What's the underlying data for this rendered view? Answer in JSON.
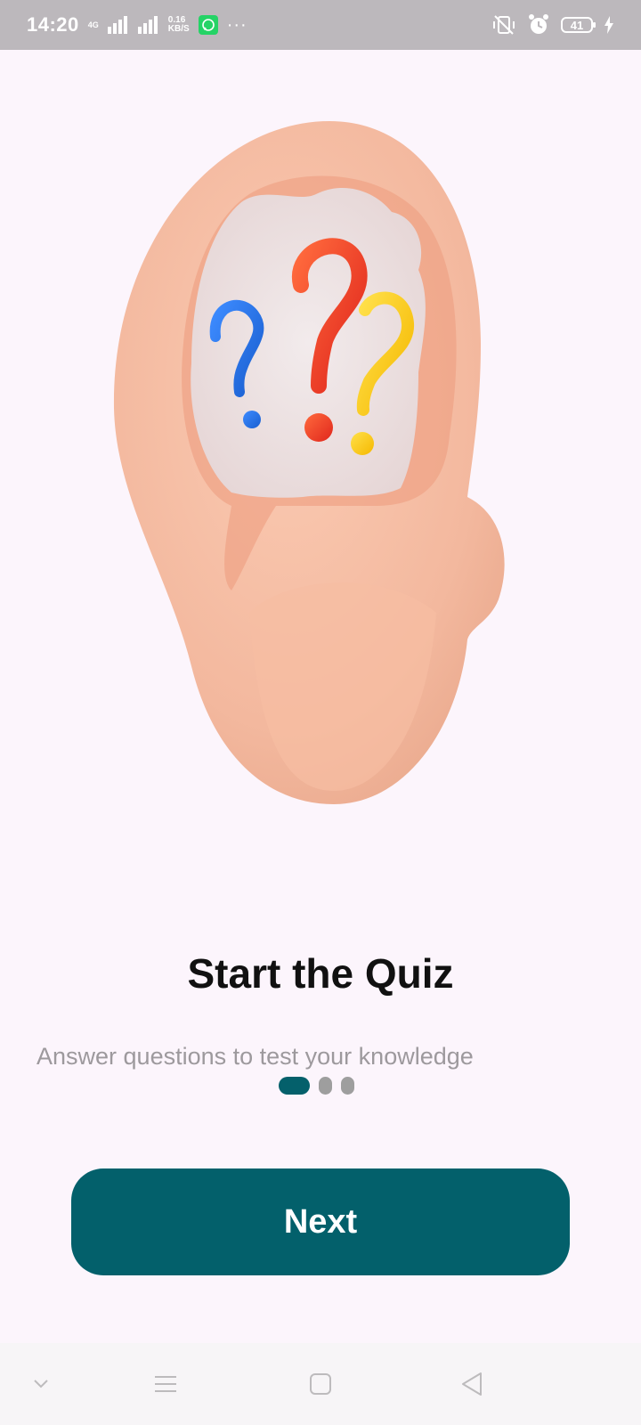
{
  "status_bar": {
    "time": "14:20",
    "network_type": "4G",
    "net_speed_value": "0.16",
    "net_speed_unit": "KB/S",
    "more_indicator": "···",
    "battery_level": "41"
  },
  "onboarding": {
    "title": "Start the Quiz",
    "subtitle": "Answer questions to test your knowledge",
    "pages_total": 3,
    "current_page": 1,
    "next_label": "Next"
  },
  "colors": {
    "background": "#fcf5fc",
    "accent": "#03606b",
    "status_bar": "#bcb8bc",
    "inactive_dot": "#9e9e9e",
    "subtitle_text": "#9d999d"
  },
  "icons": {
    "status": [
      "data-arrows-icon",
      "signal-icon",
      "whatsapp-icon",
      "mute-vibrate-icon",
      "alarm-icon",
      "battery-icon",
      "charging-icon"
    ],
    "navigation": [
      "collapse-icon",
      "menu-icon",
      "home-icon",
      "back-icon"
    ]
  }
}
